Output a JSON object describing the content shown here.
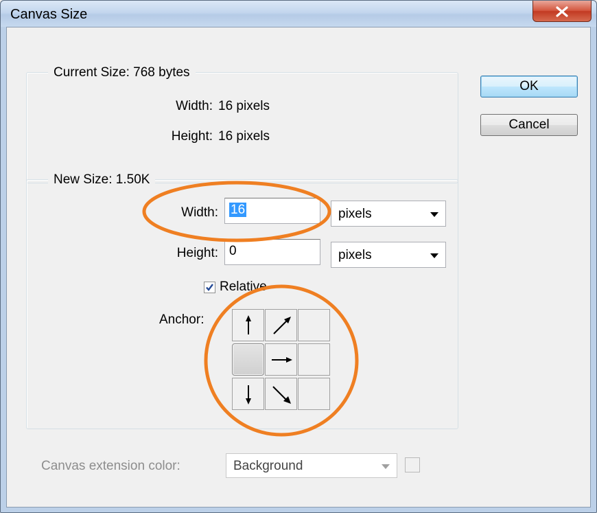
{
  "window": {
    "title": "Canvas Size",
    "close_icon": "close-icon"
  },
  "current_size": {
    "legend": "Current Size: 768 bytes",
    "width_label": "Width:",
    "width_value": "16 pixels",
    "height_label": "Height:",
    "height_value": "16 pixels"
  },
  "new_size": {
    "legend": "New Size: 1.50K",
    "width_label": "Width:",
    "width_value": "16",
    "width_unit": "pixels",
    "height_label": "Height:",
    "height_value": "0",
    "height_unit": "pixels",
    "relative_label": "Relative",
    "relative_checked": true,
    "anchor_label": "Anchor:",
    "anchor_selected": "middle-left",
    "anchor_icons": [
      "arrow-up-icon",
      "arrow-up-right-icon",
      "",
      "",
      "arrow-right-icon",
      "",
      "arrow-down-icon",
      "arrow-down-right-icon",
      ""
    ]
  },
  "buttons": {
    "ok": "OK",
    "cancel": "Cancel"
  },
  "extension": {
    "label": "Canvas extension color:",
    "value": "Background"
  },
  "colors": {
    "annotation": "#ef7f22",
    "selection": "#3399ff",
    "window_frame": "#bcd0e8",
    "dialog_bg": "#f0f0f0"
  }
}
